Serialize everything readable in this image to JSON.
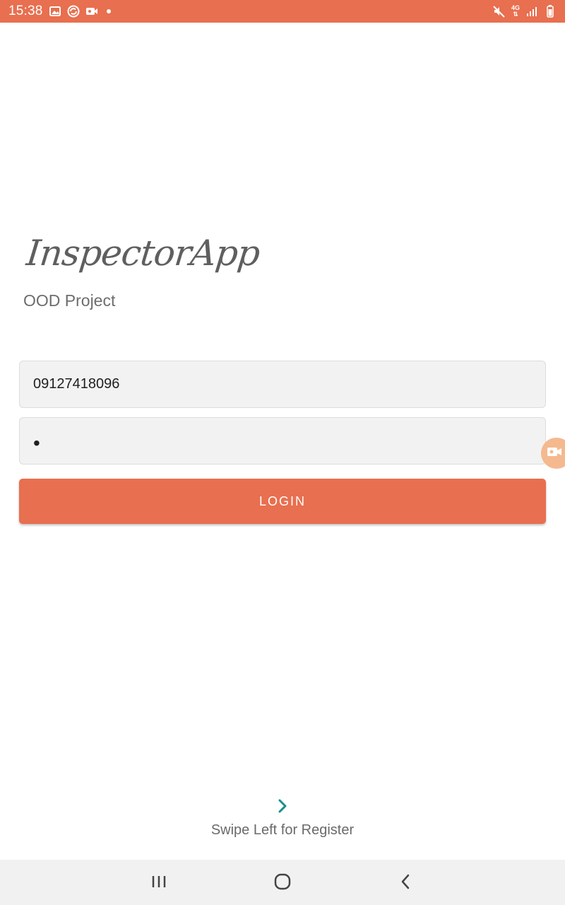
{
  "status_bar": {
    "time": "15:38",
    "left_icons": [
      "gallery-icon",
      "sync-icon",
      "screen-record-icon",
      "notification-dot-icon"
    ],
    "right_icons": [
      "mute-icon",
      "network-4g-icon",
      "signal-icon",
      "battery-icon"
    ],
    "network_label": "4G"
  },
  "app": {
    "logo_text": "InspectorApp",
    "subtitle": "OOD Project"
  },
  "form": {
    "phone_value": "09127418096",
    "password_value": "•",
    "login_label": "LOGIN"
  },
  "footer": {
    "swipe_text": "Swipe Left for Register",
    "chevron_icon": "chevron-right-icon"
  },
  "nav_bar": {
    "buttons": [
      "recents-icon",
      "home-icon",
      "back-icon"
    ]
  },
  "colors": {
    "accent": "#E86F4F",
    "input_bg": "#F2F2F2",
    "teal": "#1A8F8C",
    "nav_bg": "#F1F1F1"
  }
}
